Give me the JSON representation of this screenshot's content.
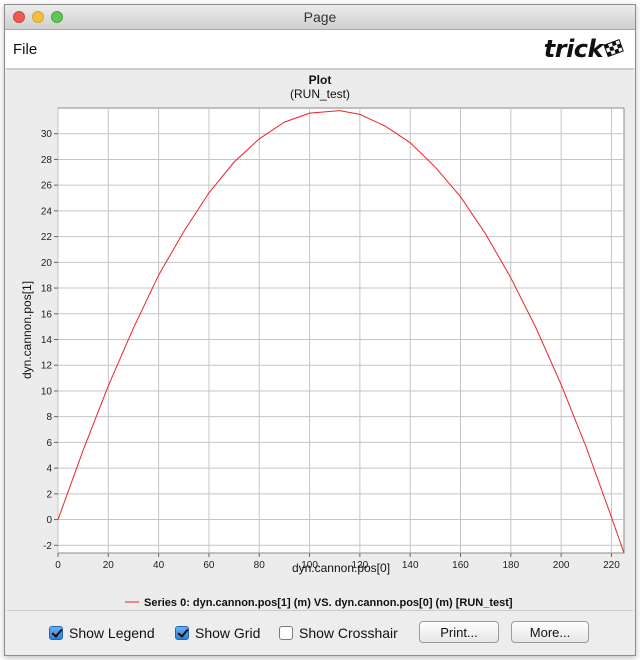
{
  "window": {
    "title": "Page"
  },
  "menu": {
    "file": "File"
  },
  "logo": {
    "text": "trick"
  },
  "plot": {
    "title": "Plot",
    "subtitle": "(RUN_test)",
    "legend": "Series 0: dyn.cannon.pos[1] (m) VS. dyn.cannon.pos[0] (m) [RUN_test]"
  },
  "chart_data": {
    "type": "line",
    "title": "Plot",
    "subtitle": "(RUN_test)",
    "xlabel": "dyn.cannon.pos[0]",
    "ylabel": "dyn.cannon.pos[1]",
    "xlim": [
      0,
      225
    ],
    "ylim": [
      -2.6,
      32
    ],
    "xticks": [
      0,
      20,
      40,
      60,
      80,
      100,
      120,
      140,
      160,
      180,
      200,
      220
    ],
    "yticks": [
      -2,
      0,
      2,
      4,
      6,
      8,
      10,
      12,
      14,
      16,
      18,
      20,
      22,
      24,
      26,
      28,
      30
    ],
    "grid": true,
    "legend_position": "bottom",
    "series": [
      {
        "name": "Series 0: dyn.cannon.pos[1] (m) VS. dyn.cannon.pos[0] (m) [RUN_test]",
        "color": "#e8242a",
        "x": [
          0,
          10,
          20,
          30,
          40,
          50,
          60,
          70,
          80,
          90,
          100,
          112,
          120,
          130,
          140,
          150,
          160,
          170,
          180,
          190,
          200,
          210,
          220,
          225
        ],
        "y": [
          0,
          5.4,
          10.4,
          14.9,
          19.0,
          22.4,
          25.4,
          27.8,
          29.6,
          30.9,
          31.6,
          31.8,
          31.5,
          30.6,
          29.3,
          27.4,
          25.1,
          22.2,
          18.8,
          14.9,
          10.5,
          5.6,
          0.2,
          -2.6
        ]
      }
    ]
  },
  "controls": {
    "show_legend": {
      "label": "Show Legend",
      "checked": true
    },
    "show_grid": {
      "label": "Show Grid",
      "checked": true
    },
    "show_crosshair": {
      "label": "Show Crosshair",
      "checked": false
    },
    "print": "Print...",
    "more": "More..."
  }
}
